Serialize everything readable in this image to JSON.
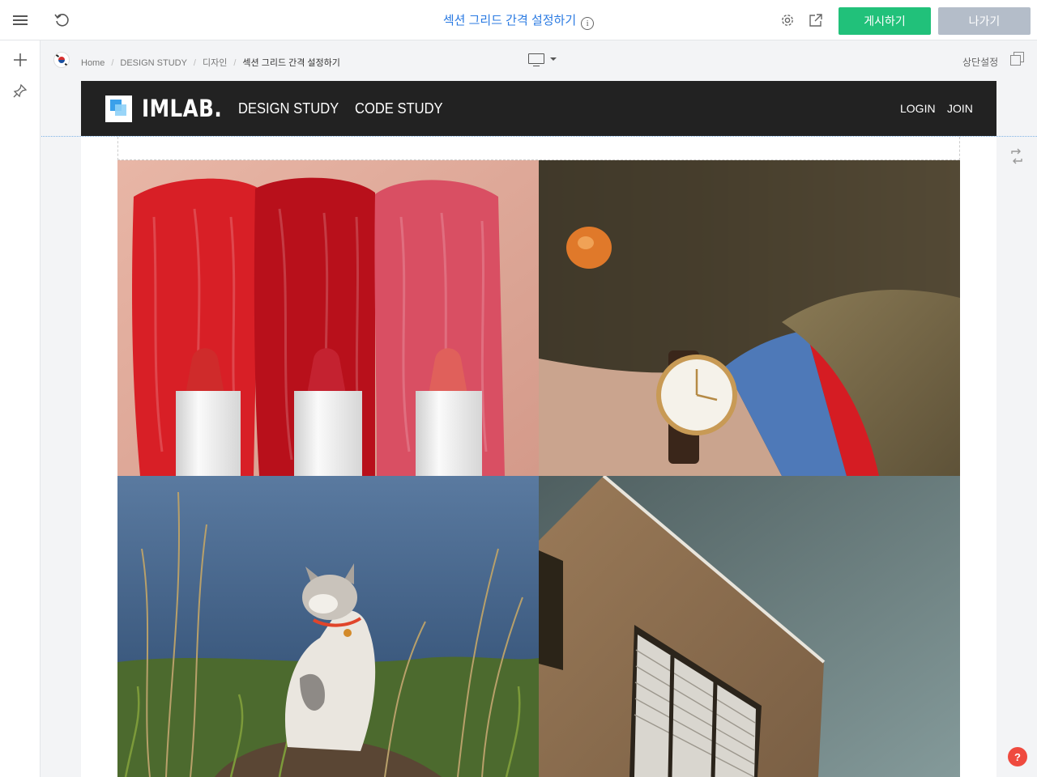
{
  "topbar": {
    "title": "섹션 그리드 간격 설정하기",
    "info_glyph": "i",
    "publish_label": "게시하기",
    "exit_label": "나가기",
    "icons": [
      "menu-icon",
      "undo-icon",
      "gear-icon",
      "external-link-icon"
    ]
  },
  "sidebar": {
    "icons": [
      "plus-icon",
      "pin-icon"
    ]
  },
  "editor": {
    "breadcrumbs": [
      "Home",
      "DESIGN STUDY",
      "디자인",
      "섹션 그리드 간격 설정하기"
    ],
    "separator": "/",
    "device": "desktop-icon",
    "top_setting_label": "상단설정"
  },
  "site": {
    "logo_text": "IMLAB.",
    "nav": [
      "DESIGN STUDY",
      "CODE STUDY"
    ],
    "login_label": "LOGIN",
    "join_label": "JOIN"
  },
  "grid": {
    "images": [
      "lipstick-swatches-image",
      "wristwatch-image",
      "cat-in-grass-image",
      "building-facade-image"
    ]
  },
  "help_label": "?",
  "colors": {
    "accent_blue": "#2a7ae2",
    "publish_green": "#21c17a",
    "exit_gray": "#b4bdc9",
    "site_header": "#222222",
    "help_red": "#ef4a3f"
  }
}
